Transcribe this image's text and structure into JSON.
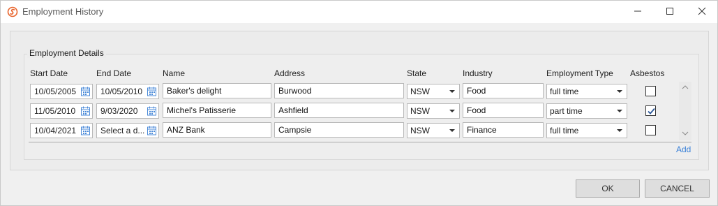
{
  "window": {
    "title": "Employment History"
  },
  "group": {
    "legend": "Employment Details"
  },
  "columns": {
    "start_date": "Start Date",
    "end_date": "End Date",
    "name": "Name",
    "address": "Address",
    "state": "State",
    "industry": "Industry",
    "employment_type": "Employment Type",
    "asbestos": "Asbestos"
  },
  "rows": [
    {
      "start_date": "10/05/2005",
      "end_date": "10/05/2010",
      "name": "Baker's delight",
      "address": "Burwood",
      "state": "NSW",
      "industry": "Food",
      "employment_type": "full time",
      "asbestos": false
    },
    {
      "start_date": "11/05/2010",
      "end_date": "9/03/2020",
      "name": "Michel's Patisserie",
      "address": "Ashfield",
      "state": "NSW",
      "industry": "Food",
      "employment_type": "part time",
      "asbestos": true
    },
    {
      "start_date": "10/04/2021",
      "end_date": "Select a d...",
      "name": "ANZ Bank",
      "address": "Campsie",
      "state": "NSW",
      "industry": "Finance",
      "employment_type": "full time",
      "asbestos": false
    }
  ],
  "actions": {
    "add": "Add",
    "ok": "OK",
    "cancel": "CANCEL"
  },
  "colors": {
    "accent": "#3c82d8",
    "brand_icon": "#e8642c",
    "checkmark": "#2b5797"
  },
  "icons": {
    "app": "app-logo-icon",
    "calendar": "calendar-icon",
    "minimize": "minimize-icon",
    "maximize": "maximize-icon",
    "close": "close-icon"
  }
}
